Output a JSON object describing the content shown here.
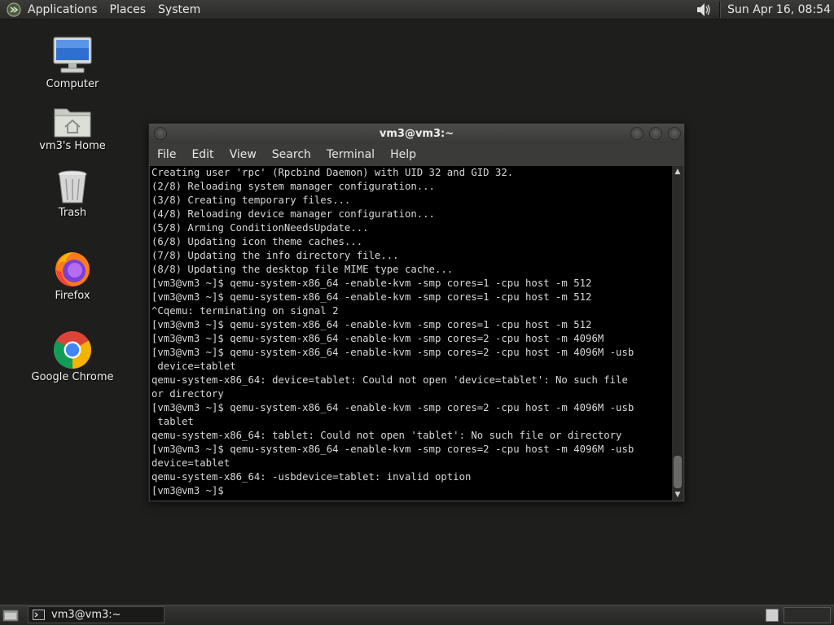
{
  "top_panel": {
    "menus": [
      "Applications",
      "Places",
      "System"
    ],
    "clock": "Sun Apr 16, 08:54"
  },
  "desktop_icons": [
    {
      "label": "Computer",
      "icon": "computer-icon"
    },
    {
      "label": "vm3's Home",
      "icon": "home-folder-icon"
    },
    {
      "label": "Trash",
      "icon": "trash-icon"
    },
    {
      "label": "Firefox",
      "icon": "firefox-icon"
    },
    {
      "label": "Google Chrome",
      "icon": "chrome-icon"
    }
  ],
  "terminal": {
    "title": "vm3@vm3:~",
    "menu": [
      "File",
      "Edit",
      "View",
      "Search",
      "Terminal",
      "Help"
    ],
    "lines": [
      "Creating user 'rpc' (Rpcbind Daemon) with UID 32 and GID 32.",
      "(2/8) Reloading system manager configuration...",
      "(3/8) Creating temporary files...",
      "(4/8) Reloading device manager configuration...",
      "(5/8) Arming ConditionNeedsUpdate...",
      "(6/8) Updating icon theme caches...",
      "(7/8) Updating the info directory file...",
      "(8/8) Updating the desktop file MIME type cache...",
      "[vm3@vm3 ~]$ qemu-system-x86_64 -enable-kvm -smp cores=1 -cpu host -m 512",
      "[vm3@vm3 ~]$ qemu-system-x86_64 -enable-kvm -smp cores=1 -cpu host -m 512",
      "^Cqemu: terminating on signal 2",
      "[vm3@vm3 ~]$ qemu-system-x86_64 -enable-kvm -smp cores=1 -cpu host -m 512",
      "[vm3@vm3 ~]$ qemu-system-x86_64 -enable-kvm -smp cores=2 -cpu host -m 4096M",
      "[vm3@vm3 ~]$ qemu-system-x86_64 -enable-kvm -smp cores=2 -cpu host -m 4096M -usb",
      " device=tablet",
      "qemu-system-x86_64: device=tablet: Could not open 'device=tablet': No such file",
      "or directory",
      "[vm3@vm3 ~]$ qemu-system-x86_64 -enable-kvm -smp cores=2 -cpu host -m 4096M -usb",
      " tablet",
      "qemu-system-x86_64: tablet: Could not open 'tablet': No such file or directory",
      "[vm3@vm3 ~]$ qemu-system-x86_64 -enable-kvm -smp cores=2 -cpu host -m 4096M -usb",
      "device=tablet",
      "qemu-system-x86_64: -usbdevice=tablet: invalid option",
      "[vm3@vm3 ~]$ "
    ]
  },
  "taskbar": {
    "window_button": "vm3@vm3:~"
  }
}
